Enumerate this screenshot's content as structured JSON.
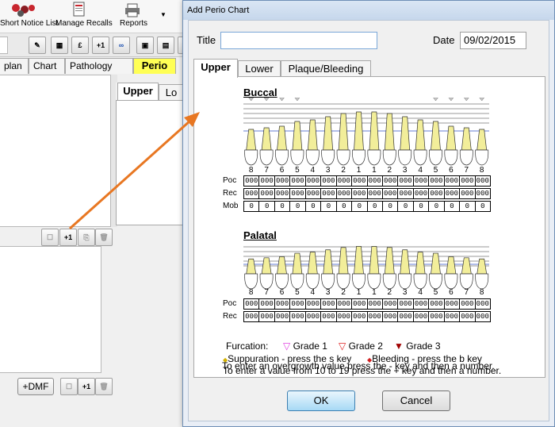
{
  "toolbar": {
    "items": [
      {
        "label": "Short Notice List",
        "icon": "puzzle-icon"
      },
      {
        "label": "Manage Recalls",
        "icon": "document-icon"
      },
      {
        "label": "Reports",
        "icon": "printer-icon"
      }
    ]
  },
  "app": {
    "tabs": [
      "plan",
      "Chart",
      "Pathology",
      "Perio"
    ],
    "perio_tab_color": "#ffff55",
    "sub_tabs": [
      "Upper",
      "Lo"
    ],
    "dmf_button": "+DMF",
    "plus1": "+1"
  },
  "dialog": {
    "title": "Add Perio Chart",
    "title_label": "Title",
    "title_value": "",
    "date_label": "Date",
    "date_value": "09/02/2015",
    "tabs": [
      "Upper",
      "Lower",
      "Plaque/Bleeding"
    ],
    "buccal": {
      "heading": "Buccal",
      "tooth_numbers": [
        "8",
        "7",
        "6",
        "5",
        "4",
        "3",
        "2",
        "1",
        "1",
        "2",
        "3",
        "4",
        "5",
        "6",
        "7",
        "8"
      ],
      "rows": [
        {
          "label": "Poc",
          "values": [
            "000",
            "000",
            "000",
            "000",
            "000",
            "000",
            "000",
            "000",
            "000",
            "000",
            "000",
            "000",
            "000",
            "000",
            "000",
            "000"
          ]
        },
        {
          "label": "Rec",
          "values": [
            "000",
            "000",
            "000",
            "000",
            "000",
            "000",
            "000",
            "000",
            "000",
            "000",
            "000",
            "000",
            "000",
            "000",
            "000",
            "000"
          ]
        },
        {
          "label": "Mob",
          "values": [
            "0",
            "0",
            "0",
            "0",
            "0",
            "0",
            "0",
            "0",
            "0",
            "0",
            "0",
            "0",
            "0",
            "0",
            "0",
            "0"
          ]
        }
      ]
    },
    "palatal": {
      "heading": "Palatal",
      "tooth_numbers": [
        "8",
        "7",
        "6",
        "5",
        "4",
        "3",
        "2",
        "1",
        "1",
        "2",
        "3",
        "4",
        "5",
        "6",
        "7",
        "8"
      ],
      "rows": [
        {
          "label": "Poc",
          "values": [
            "000",
            "000",
            "000",
            "000",
            "000",
            "000",
            "000",
            "000",
            "000",
            "000",
            "000",
            "000",
            "000",
            "000",
            "000",
            "000"
          ]
        },
        {
          "label": "Rec",
          "values": [
            "000",
            "000",
            "000",
            "000",
            "000",
            "000",
            "000",
            "000",
            "000",
            "000",
            "000",
            "000",
            "000",
            "000",
            "000",
            "000"
          ]
        }
      ]
    },
    "furcation_label": "Furcation:",
    "grades": [
      {
        "label": "Grade 1",
        "color": "#e040e0"
      },
      {
        "label": "Grade 2",
        "color": "#e02020"
      },
      {
        "label": "Grade 3",
        "color": "#a00000"
      }
    ],
    "suppuration": "Suppuration - press the s key",
    "bleeding": "Bleeding - press the b key",
    "instr1": "To enter a value from 10 to 19 press the + key and then a number.",
    "instr2": "To enter an overgrowth value press the - key and then a number.",
    "ok": "OK",
    "cancel": "Cancel"
  },
  "colors": {
    "arrow": "#e87722",
    "tooth_root": "#f2ee9a",
    "accent": "#3c7fb1"
  }
}
